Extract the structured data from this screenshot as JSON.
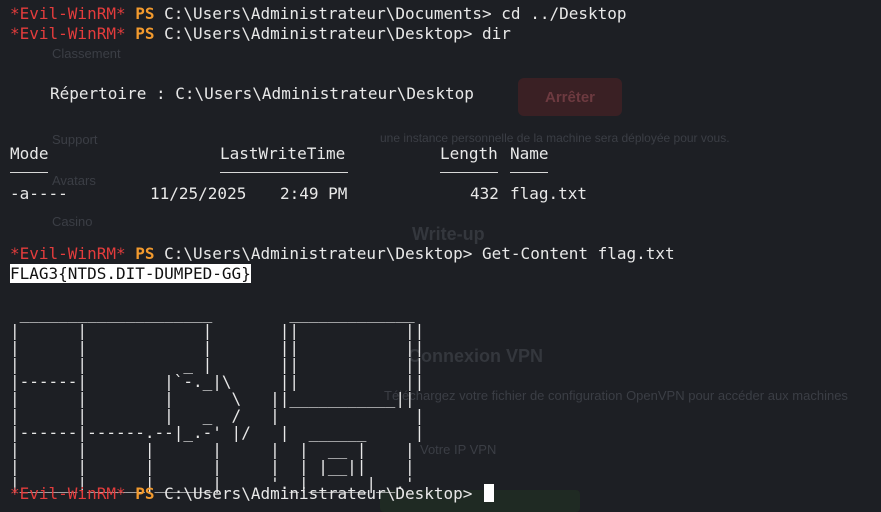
{
  "prompt": {
    "tag": "*Evil-WinRM*",
    "ps": "PS"
  },
  "lines": {
    "l1": "C:\\Users\\Administrateur\\Documents> cd ../Desktop",
    "l2": "C:\\Users\\Administrateur\\Desktop> dir",
    "dir_label": "Répertoire : C:\\Users\\Administrateur\\Desktop",
    "l3": "C:\\Users\\Administrateur\\Desktop> Get-Content flag.txt",
    "flag": "FLAG3{NTDS.DIT-DUMPED-GG}",
    "l4": "C:\\Users\\Administrateur\\Desktop> "
  },
  "table": {
    "headers": {
      "mode": "Mode",
      "time": "LastWriteTime",
      "length": "Length",
      "name": "Name"
    },
    "row": {
      "mode": "-a----",
      "date": "11/25/2025",
      "time": "2:49 PM",
      "length": "432",
      "name": "flag.txt"
    }
  },
  "ascii_art": " ____________________        _____________\n|      |            |       ||           ||\n|      |            |       ||           ||\n|      |          _ |       ||           ||\n|------|        |`-._|\\     ||           ||\n|      |        |      \\   ||___________||\n|      |        |   _  /   |              |\n|------|------.--|_.-' |/   |  ______     |\n|      |      |      |     |  |  __ |    |\n|      |      |      |     |  | |__||    |\n|______|______|______|     '._|______|__.'",
  "background_text": {
    "t1": "Classement",
    "t2": "Arrêter",
    "t3": "Support",
    "t4": "une instance personnelle de la machine sera déployée pour vous.",
    "t5": "Avatars",
    "t6": "Casino",
    "t7": "Write-up",
    "t8": "Connexion VPN",
    "t9": "Téléchargez votre fichier de configuration OpenVPN pour accéder aux machines",
    "t10": "Votre IP VPN"
  }
}
